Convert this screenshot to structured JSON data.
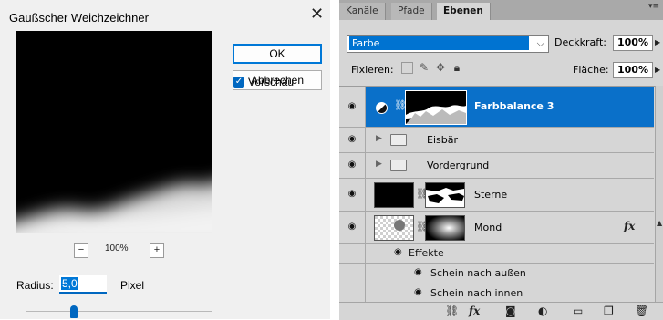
{
  "blur_dialog": {
    "title": "Gaußscher Weichzeichner",
    "close_glyph": "✕",
    "ok_label": "OK",
    "cancel_label": "Abbrechen",
    "preview_label": "Vorschau",
    "preview_checked": true,
    "zoom_out_label": "−",
    "zoom_in_label": "+",
    "zoom_percent": "100%",
    "radius_label": "Radius:",
    "radius_value": "5,0",
    "radius_unit": "Pixel",
    "accent_color": "#0067c0"
  },
  "layers_panel": {
    "tabs": [
      {
        "label": "Kanäle",
        "active": false
      },
      {
        "label": "Pfade",
        "active": false
      },
      {
        "label": "Ebenen",
        "active": true
      }
    ],
    "blend_mode": "Farbe",
    "opacity_label": "Deckkraft:",
    "opacity_value": "100%",
    "lock_label": "Fixieren:",
    "fill_label": "Fläche:",
    "fill_value": "100%",
    "layers": [
      {
        "name": "Farbbalance 3",
        "type": "adjustment",
        "selected": true
      },
      {
        "name": "Eisbär",
        "type": "group"
      },
      {
        "name": "Vordergrund",
        "type": "group"
      },
      {
        "name": "Sterne",
        "type": "layer"
      },
      {
        "name": "Mond",
        "type": "layer",
        "fx": "fx"
      }
    ],
    "effects_label": "Effekte",
    "effects": [
      "Schein nach außen",
      "Schein nach innen"
    ],
    "selection_color": "#0a70c9",
    "bottom_icons": [
      "link-icon",
      "fx-icon",
      "mask-icon",
      "adjustment-icon",
      "folder-icon",
      "new-layer-icon",
      "trash-icon"
    ]
  }
}
